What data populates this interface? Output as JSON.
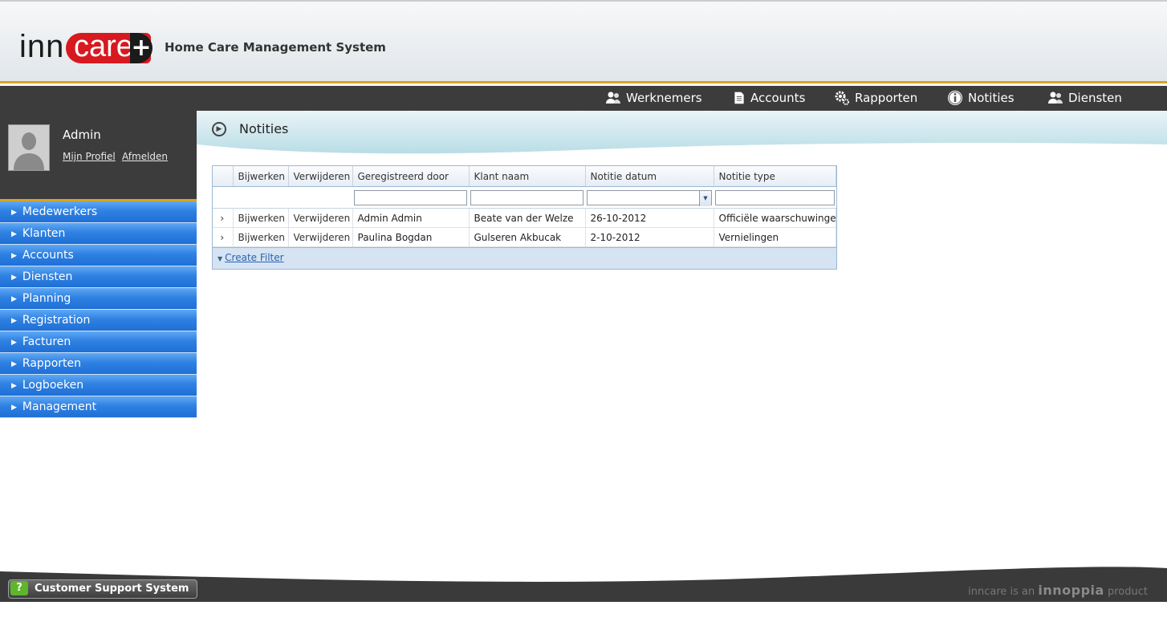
{
  "header": {
    "logo_text_1": "inn",
    "logo_text_2": "care",
    "logo_plus": "+",
    "subtitle": "Home Care Management System"
  },
  "topnav": {
    "items": [
      {
        "label": "Werknemers",
        "icon": "users-icon"
      },
      {
        "label": "Accounts",
        "icon": "document-icon"
      },
      {
        "label": "Rapporten",
        "icon": "gears-icon"
      },
      {
        "label": "Notities",
        "icon": "info-icon"
      },
      {
        "label": "Diensten",
        "icon": "users-icon"
      }
    ]
  },
  "user": {
    "name": "Admin",
    "profile_link": "Mijn Profiel",
    "logout_link": "Afmelden"
  },
  "sidebar": {
    "items": [
      {
        "label": "Medewerkers"
      },
      {
        "label": "Klanten"
      },
      {
        "label": "Accounts"
      },
      {
        "label": "Diensten"
      },
      {
        "label": "Planning"
      },
      {
        "label": "Registration"
      },
      {
        "label": "Facturen"
      },
      {
        "label": "Rapporten"
      },
      {
        "label": "Logboeken"
      },
      {
        "label": "Management"
      }
    ]
  },
  "page": {
    "title": "Notities"
  },
  "grid": {
    "columns": [
      "Bijwerken",
      "Verwijderen",
      "Geregistreerd door",
      "Klant naam",
      "Notitie datum",
      "Notitie type"
    ],
    "rows": [
      {
        "edit": "Bijwerken",
        "delete": "Verwijderen",
        "registered_by": "Admin Admin",
        "client": "Beate van der Welze",
        "date": "26-10-2012",
        "type": "Officiële waarschuwingen"
      },
      {
        "edit": "Bijwerken",
        "delete": "Verwijderen",
        "registered_by": "Paulina Bogdan",
        "client": "Gulseren Akbucak",
        "date": "2-10-2012",
        "type": "Vernielingen"
      }
    ],
    "footer_link": "Create Filter"
  },
  "footer": {
    "support_label": "Customer Support System",
    "support_icon": "?",
    "brand_prefix": "inncare is an",
    "brand_name": "innoppia",
    "brand_suffix": "product"
  },
  "colors": {
    "header_accent": "#d9a323",
    "dark_bar": "#3c3c3c",
    "menu_blue": "#2f81e2",
    "grid_border": "#9db7d3"
  }
}
